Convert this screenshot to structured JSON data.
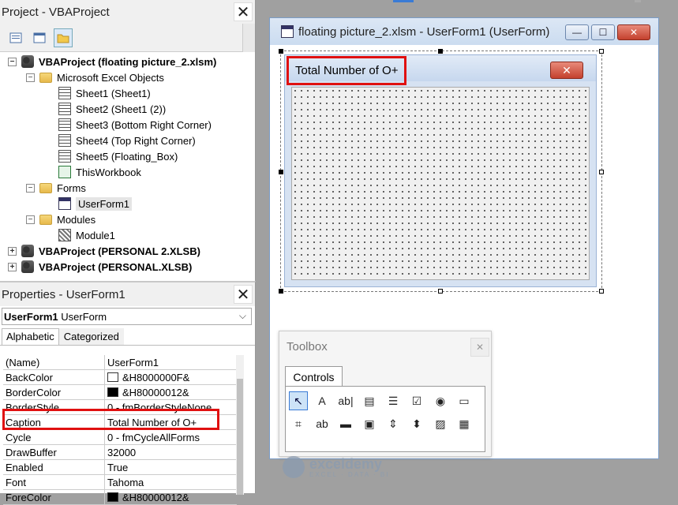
{
  "project": {
    "title": "Project - VBAProject",
    "close_glyph": "✕",
    "tree": [
      {
        "label": "VBAProject (floating picture_2.xlsm)",
        "level": 0,
        "icon": "project-icon",
        "bold": true,
        "expander": "−"
      },
      {
        "label": "Microsoft Excel Objects",
        "level": 1,
        "icon": "folder-icon",
        "bold": false,
        "expander": "−"
      },
      {
        "label": "Sheet1 (Sheet1)",
        "level": 2,
        "icon": "sheet-icon",
        "bold": false,
        "expander": ""
      },
      {
        "label": "Sheet2 (Sheet1 (2))",
        "level": 2,
        "icon": "sheet-icon",
        "bold": false,
        "expander": ""
      },
      {
        "label": "Sheet3 (Bottom Right Corner)",
        "level": 2,
        "icon": "sheet-icon",
        "bold": false,
        "expander": ""
      },
      {
        "label": "Sheet4 (Top Right Corner)",
        "level": 2,
        "icon": "sheet-icon",
        "bold": false,
        "expander": ""
      },
      {
        "label": "Sheet5 (Floating_Box)",
        "level": 2,
        "icon": "sheet-icon",
        "bold": false,
        "expander": ""
      },
      {
        "label": "ThisWorkbook",
        "level": 2,
        "icon": "workbook-icon",
        "bold": false,
        "expander": ""
      },
      {
        "label": "Forms",
        "level": 1,
        "icon": "folder-icon",
        "bold": false,
        "expander": "−"
      },
      {
        "label": "UserForm1",
        "level": 2,
        "icon": "form-icon",
        "bold": false,
        "expander": "",
        "selected": true
      },
      {
        "label": "Modules",
        "level": 1,
        "icon": "folder-icon",
        "bold": false,
        "expander": "−"
      },
      {
        "label": "Module1",
        "level": 2,
        "icon": "module-icon",
        "bold": false,
        "expander": ""
      },
      {
        "label": "VBAProject (PERSONAL 2.XLSB)",
        "level": 0,
        "icon": "project-icon",
        "bold": true,
        "expander": "+"
      },
      {
        "label": "VBAProject (PERSONAL.XLSB)",
        "level": 0,
        "icon": "project-icon",
        "bold": true,
        "expander": "+"
      }
    ]
  },
  "properties": {
    "title": "Properties - UserForm1",
    "close_glyph": "✕",
    "object_name": "UserForm1",
    "object_type": "UserForm",
    "chevron": "⌵",
    "tabs": [
      "Alphabetic",
      "Categorized"
    ],
    "rows": [
      {
        "name": "(Name)",
        "value": "UserForm1",
        "swatch": null
      },
      {
        "name": "BackColor",
        "value": "&H8000000F&",
        "swatch": "#ffffff"
      },
      {
        "name": "BorderColor",
        "value": "&H80000012&",
        "swatch": "#000000"
      },
      {
        "name": "BorderStyle",
        "value": "0 - fmBorderStyleNone",
        "swatch": null
      },
      {
        "name": "Caption",
        "value": "Total Number of O+",
        "swatch": null,
        "highlight": true
      },
      {
        "name": "Cycle",
        "value": "0 - fmCycleAllForms",
        "swatch": null
      },
      {
        "name": "DrawBuffer",
        "value": "32000",
        "swatch": null
      },
      {
        "name": "Enabled",
        "value": "True",
        "swatch": null
      },
      {
        "name": "Font",
        "value": "Tahoma",
        "swatch": null
      },
      {
        "name": "ForeColor",
        "value": "&H80000012&",
        "swatch": "#000000"
      }
    ]
  },
  "designer": {
    "window_title": "floating picture_2.xlsm - UserForm1 (UserForm)",
    "minimize_glyph": "—",
    "maximize_glyph": "☐",
    "close_glyph": "✕",
    "form_caption": "Total Number of O+",
    "form_close_glyph": "✕"
  },
  "toolbox": {
    "title": "Toolbox",
    "close_glyph": "✕",
    "tab": "Controls",
    "tools": [
      {
        "name": "select-objects-tool",
        "glyph": "↖",
        "active": true
      },
      {
        "name": "label-tool",
        "glyph": "A"
      },
      {
        "name": "textbox-tool",
        "glyph": "ab|"
      },
      {
        "name": "combobox-tool",
        "glyph": "▤"
      },
      {
        "name": "listbox-tool",
        "glyph": "☰"
      },
      {
        "name": "checkbox-tool",
        "glyph": "☑"
      },
      {
        "name": "optionbutton-tool",
        "glyph": "◉"
      },
      {
        "name": "togglebutton-tool",
        "glyph": "▭"
      },
      {
        "name": "frame-tool",
        "glyph": "⌗"
      },
      {
        "name": "commandbutton-tool",
        "glyph": "ab"
      },
      {
        "name": "tabstrip-tool",
        "glyph": "▬"
      },
      {
        "name": "multipage-tool",
        "glyph": "▣"
      },
      {
        "name": "scrollbar-tool",
        "glyph": "⇕"
      },
      {
        "name": "spinbutton-tool",
        "glyph": "⬍"
      },
      {
        "name": "image-tool",
        "glyph": "▨"
      },
      {
        "name": "refedit-tool",
        "glyph": "▦"
      }
    ]
  },
  "watermark": {
    "name": "exceldemy",
    "tagline": "EXCEL · DATA · BI"
  }
}
